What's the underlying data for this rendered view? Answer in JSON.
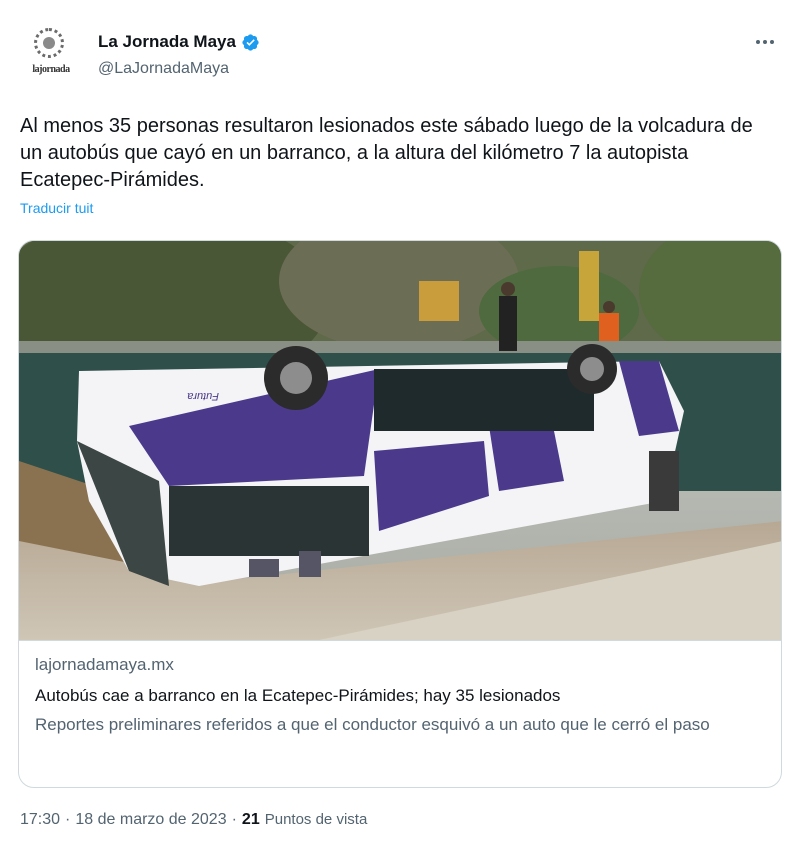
{
  "author": {
    "display_name": "La Jornada Maya",
    "handle": "@LaJornadaMaya",
    "avatar_text": "lajornada",
    "verified_icon": "verified-badge-icon"
  },
  "menu": {
    "icon": "more-horizontal-icon"
  },
  "tweet": {
    "text": "Al menos 35 personas resultaron lesionados este sábado luego de la volcadura de un autobús que cayó en un barranco, a la altura del kilómetro 7 la autopista Ecatepec-Pirámides.",
    "translate_label": "Traducir tuit"
  },
  "card": {
    "image_alt_subject": "bus-overturned-photo",
    "bus_brand_text": "Futura",
    "domain": "lajornadamaya.mx",
    "title": "Autobús cae a barranco en la Ecatepec-Pirámides; hay 35 lesionados",
    "description": "Reportes preliminares referidos a que el conductor esquivó a un auto que le cerró el paso"
  },
  "meta": {
    "time": "17:30",
    "separator": "·",
    "date": "18 de marzo de 2023",
    "views_count": "21",
    "views_label": "Puntos de vista"
  },
  "colors": {
    "accent": "#1d9bf0",
    "text": "#0f1419",
    "secondary": "#536471",
    "border": "#cfd9de",
    "bus_purple": "#4b3a8c"
  }
}
